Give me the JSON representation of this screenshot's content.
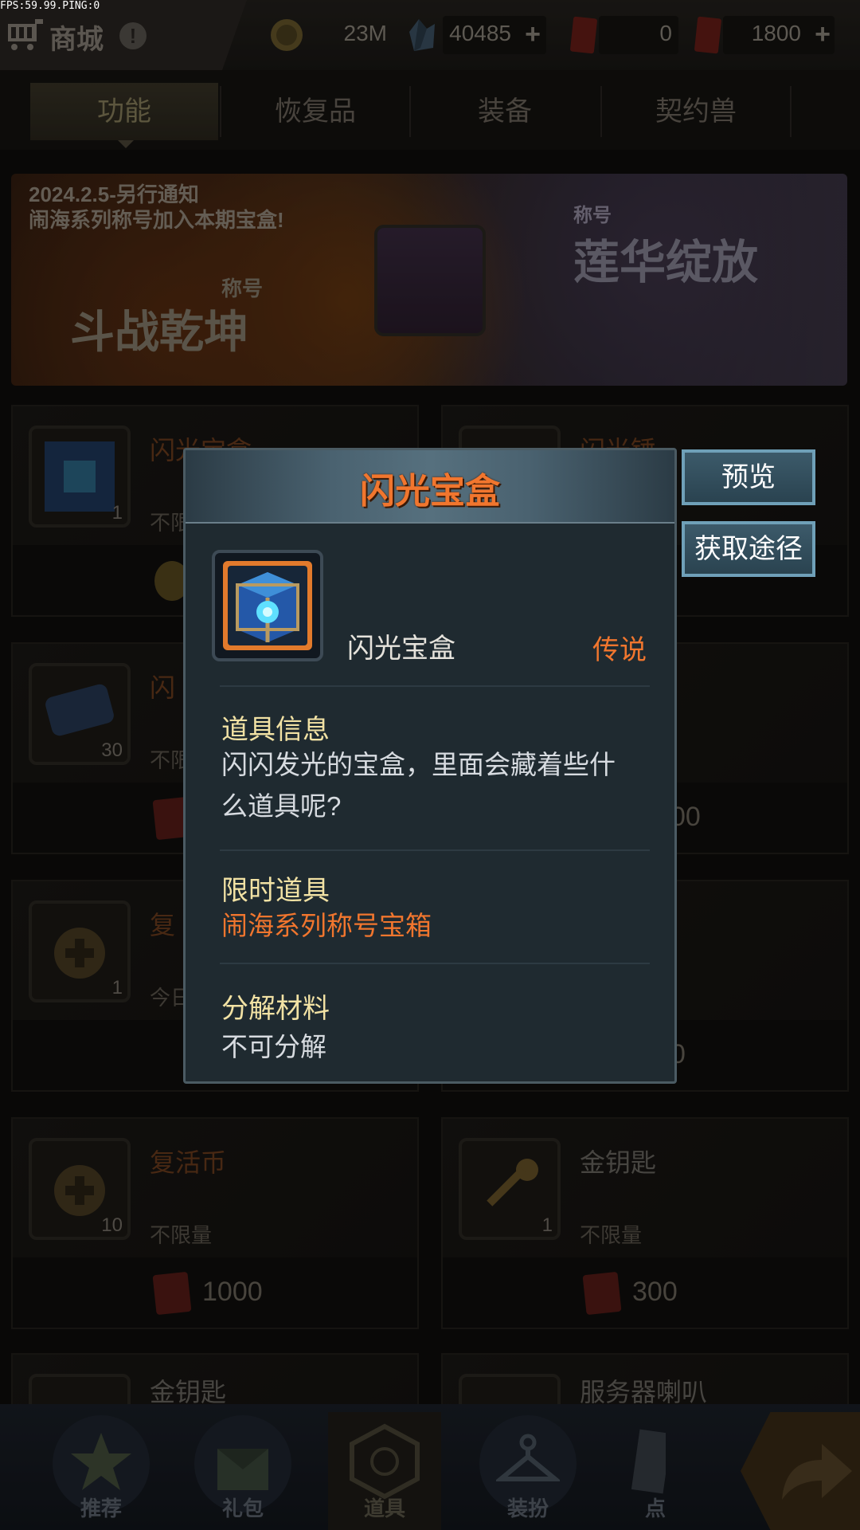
{
  "debug": {
    "fps_text": "FPS:59.99.PING:0"
  },
  "header": {
    "title": "商城",
    "info_glyph": "!",
    "currencies": [
      {
        "name": "gold",
        "value": "23M",
        "icon": "gold-coin-icon"
      },
      {
        "name": "crystal",
        "value": "40485",
        "icon": "blue-crystal-icon",
        "addable": true
      },
      {
        "name": "token",
        "value": "0",
        "icon": "red-ticket-icon"
      },
      {
        "name": "points",
        "value": "1800",
        "icon": "red-points-ticket-icon",
        "addable": true
      }
    ],
    "plus_glyph": "+"
  },
  "tabs": [
    {
      "label": "功能",
      "active": true
    },
    {
      "label": "恢复品",
      "active": false
    },
    {
      "label": "装备",
      "active": false
    },
    {
      "label": "契约兽",
      "active": false
    }
  ],
  "banner": {
    "notice_line1": "2024.2.5-另行通知",
    "notice_line2": "闹海系列称号加入本期宝盒!",
    "left_tag": "称号",
    "left_title": "斗战乾坤",
    "right_tag": "称号",
    "right_title": "莲华绽放"
  },
  "cards": [
    {
      "name": "闪光宝盒",
      "qty": "1",
      "limit": "不限量",
      "price": "",
      "icon": "treasure-box-icon"
    },
    {
      "name": "闪光锤",
      "qty": "",
      "limit": "",
      "price": "",
      "icon": "hammer-icon"
    },
    {
      "name": "闪",
      "qty": "30",
      "limit": "不限",
      "price": "",
      "icon": "scroll-icon"
    },
    {
      "name": "",
      "qty": "",
      "limit": "",
      "price": "00",
      "icon": ""
    },
    {
      "name": "复",
      "qty": "1",
      "limit": "今日",
      "price": "",
      "icon": "revive-coin-icon"
    },
    {
      "name": "",
      "qty": "",
      "limit": "",
      "price": "0",
      "icon": ""
    },
    {
      "name": "复活币",
      "qty": "10",
      "limit": "不限量",
      "price": "1000",
      "icon": "revive-coin-icon"
    },
    {
      "name": "金钥匙",
      "qty": "1",
      "limit": "不限量",
      "price": "300",
      "icon": "gold-key-icon"
    },
    {
      "name": "金钥匙",
      "qty": "",
      "limit": "",
      "price": "",
      "icon": "gold-key-icon"
    },
    {
      "name": "服务器喇叭",
      "qty": "",
      "limit": "",
      "price": "",
      "icon": "speaker-icon"
    }
  ],
  "modal": {
    "title": "闪光宝盒",
    "item_name": "闪光宝盒",
    "rarity": "传说",
    "info_title": "道具信息",
    "info_line1": "闪闪发光的宝盒，里面会藏着些什",
    "info_line2": "么道具呢?",
    "limited_title": "限时道具",
    "limited_body": "闹海系列称号宝箱",
    "decompose_title": "分解材料",
    "decompose_body": "不可分解",
    "preview_button": "预览",
    "obtain_button": "获取途径"
  },
  "bottom_nav": [
    {
      "label": "推荐",
      "icon": "star-icon",
      "active": false
    },
    {
      "label": "礼包",
      "icon": "gift-bag-icon",
      "active": false
    },
    {
      "label": "道具",
      "icon": "hexagon-item-icon",
      "active": true
    },
    {
      "label": "装扮",
      "icon": "hanger-icon",
      "active": false
    },
    {
      "label": "点",
      "icon": "points-card-icon",
      "active": false
    }
  ],
  "colors": {
    "accent_orange": "#f1762e",
    "section_title": "#f2e2a4",
    "button_blue": "#3c5a6a"
  }
}
